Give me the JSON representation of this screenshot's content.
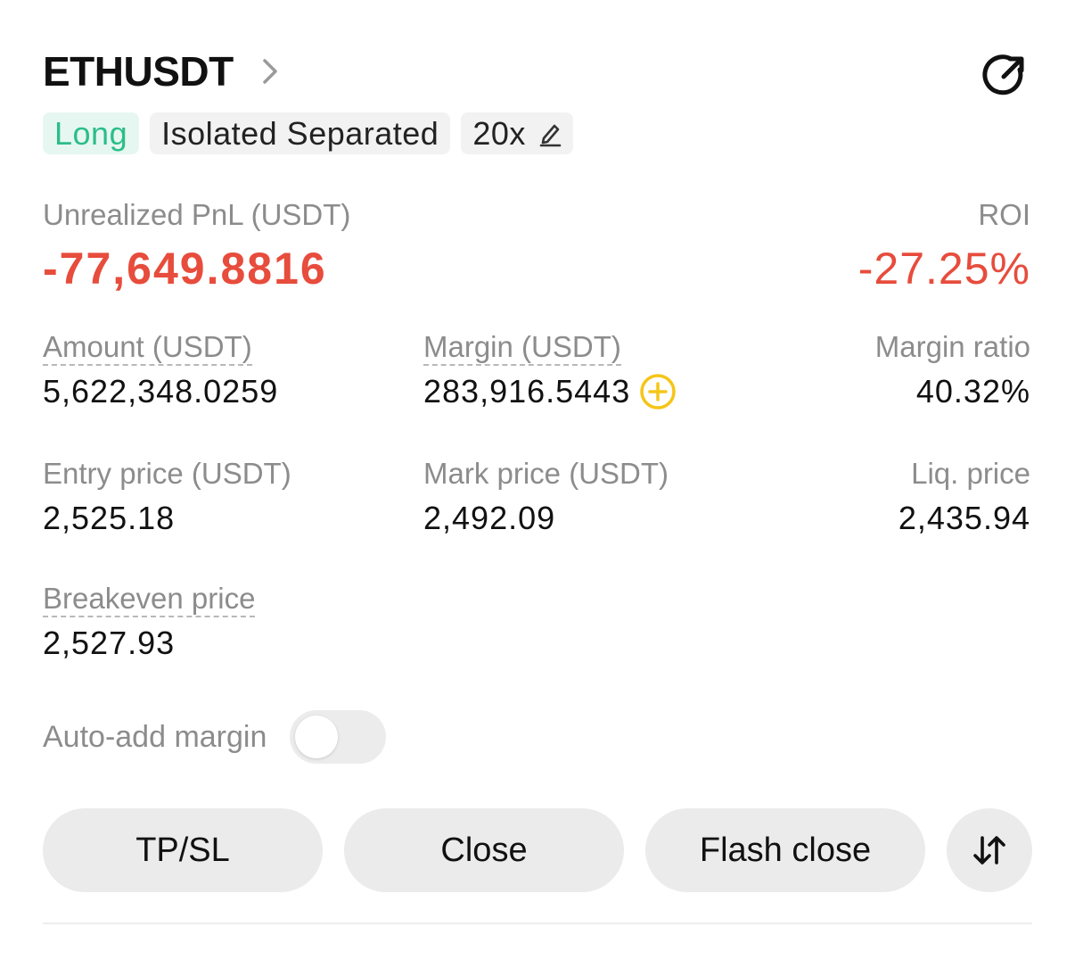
{
  "position": {
    "symbol": "ETHUSDT",
    "side": "Long",
    "margin_mode": "Isolated Separated",
    "leverage": "20x"
  },
  "pnl": {
    "label": "Unrealized PnL (USDT)",
    "value": "-77,649.8816",
    "roi_label": "ROI",
    "roi_value": "-27.25%"
  },
  "stats": {
    "amount": {
      "label": "Amount (USDT)",
      "value": "5,622,348.0259"
    },
    "margin": {
      "label": "Margin (USDT)",
      "value": "283,916.5443"
    },
    "margin_ratio": {
      "label": "Margin ratio",
      "value": "40.32%"
    },
    "entry_price": {
      "label": "Entry price (USDT)",
      "value": "2,525.18"
    },
    "mark_price": {
      "label": "Mark price (USDT)",
      "value": "2,492.09"
    },
    "liq_price": {
      "label": "Liq. price",
      "value": "2,435.94"
    },
    "breakeven_price": {
      "label": "Breakeven price",
      "value": "2,527.93"
    }
  },
  "auto_add_margin": {
    "label": "Auto-add margin",
    "enabled": false
  },
  "actions": {
    "tpsl": "TP/SL",
    "close": "Close",
    "flash_close": "Flash close"
  },
  "colors": {
    "long_green": "#2bbd8a",
    "loss_red": "#e74c3c",
    "add_yellow": "#f5c518",
    "button_bg": "#ebebeb"
  },
  "icons": {
    "symbol_arrow": "chevron-right-icon",
    "share": "share-icon",
    "leverage_edit": "pencil-icon",
    "add_margin": "plus-circle-icon",
    "reverse": "swap-vertical-icon"
  }
}
